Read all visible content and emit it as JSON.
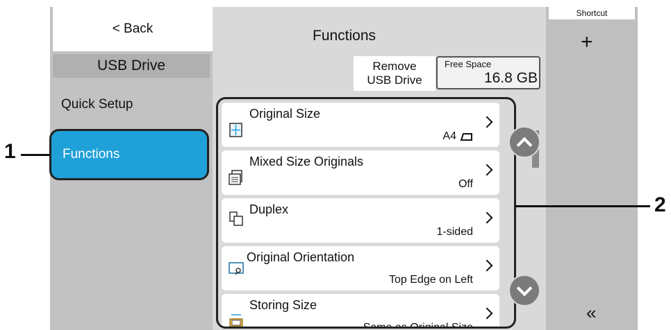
{
  "left_panel": {
    "back_label": "< Back",
    "title": "USB Drive",
    "menu": [
      "Quick Setup",
      "Functions"
    ]
  },
  "center": {
    "title": "Functions",
    "remove_usb": [
      "Remove",
      "USB Drive"
    ],
    "free_space": {
      "label": "Free Space",
      "value": "16.8 GB"
    }
  },
  "functions": [
    {
      "title": "Original Size",
      "value": "A4",
      "icon": "original-size-icon"
    },
    {
      "title": "Mixed Size Originals",
      "value": "Off",
      "icon": "mixed-size-icon"
    },
    {
      "title": "Duplex",
      "value": "1-sided",
      "icon": "duplex-icon"
    },
    {
      "title": "Original Orientation",
      "value": "Top Edge on Left",
      "icon": "orientation-icon"
    },
    {
      "title": "Storing Size",
      "value": "Same as Original Size",
      "icon": "storing-size-icon"
    }
  ],
  "right_panel": {
    "header": "Shortcut",
    "add": "+",
    "collapse": "«"
  },
  "callouts": [
    "1",
    "2"
  ],
  "colors": {
    "accent": "#1fa0d8",
    "panel": "#c2c2c2",
    "center": "#d9d9d9"
  }
}
